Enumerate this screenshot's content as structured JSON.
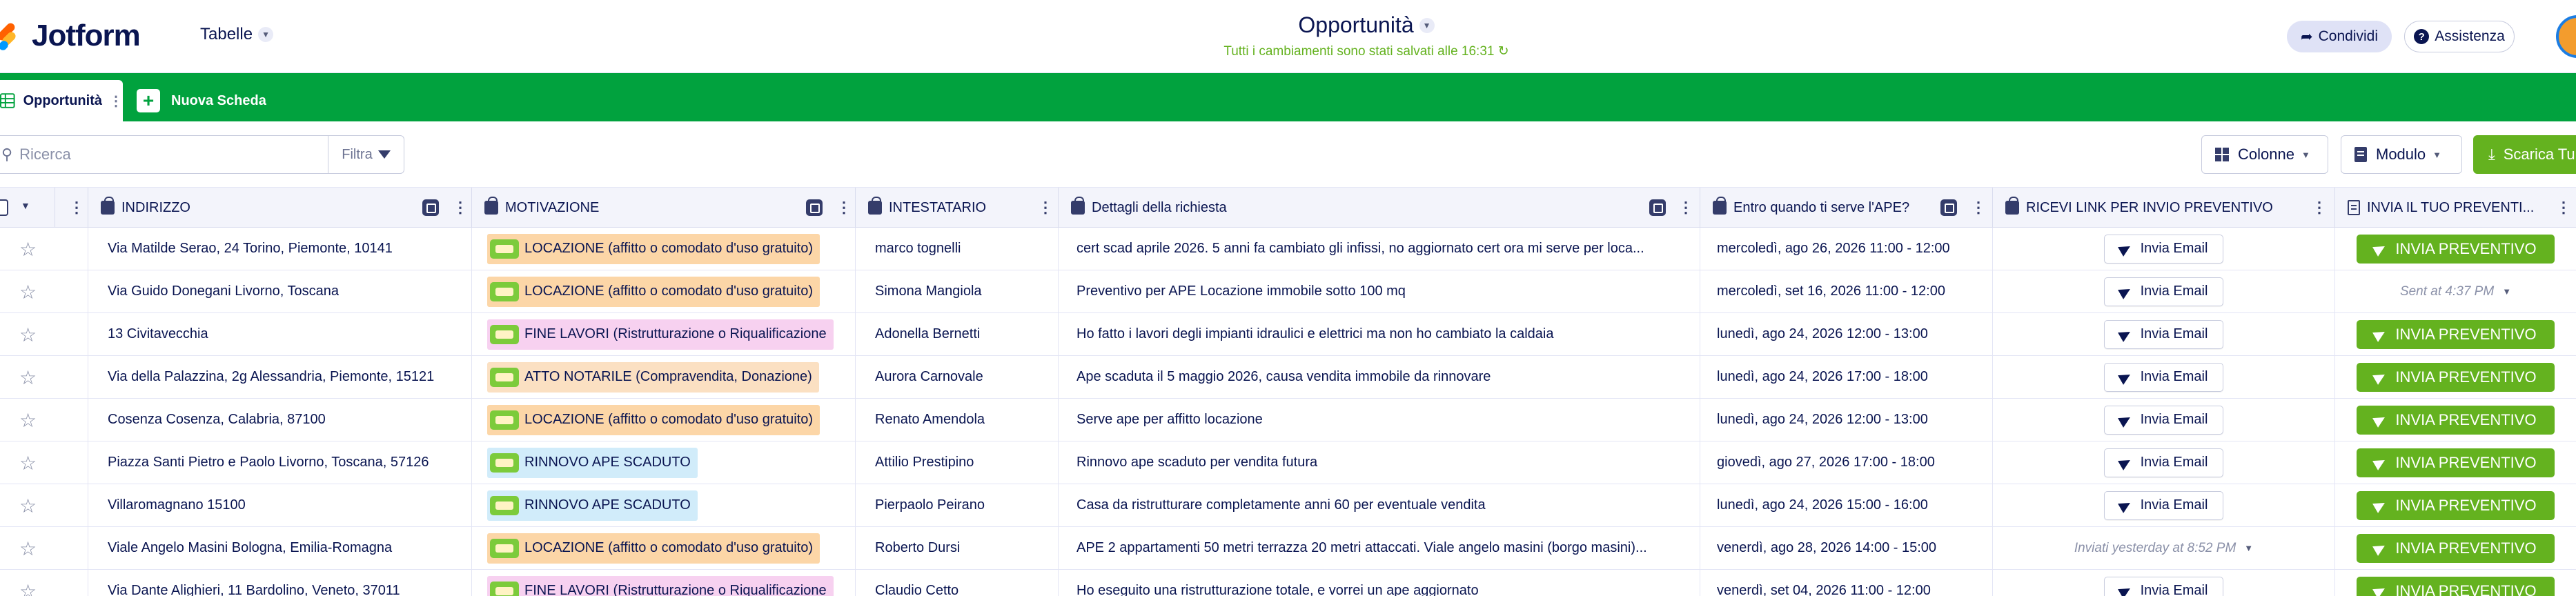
{
  "header": {
    "logo_text": "Jotform",
    "tables_label": "Tabelle",
    "title": "Opportunità",
    "saved_status": "Tutti i cambiamenti sono stati salvati alle 16:31",
    "share_label": "Condividi",
    "help_label": "Assistenza"
  },
  "tabs": {
    "active_label": "Opportunità",
    "new_label": "Nuova Scheda"
  },
  "toolbar": {
    "search_placeholder": "Ricerca",
    "filter_label": "Filtra",
    "columns_label": "Colonne",
    "form_label": "Modulo",
    "download_label": "Scarica Tu"
  },
  "columns": {
    "indirizzo": "INDIRIZZO",
    "motivazione": "MOTIVAZIONE",
    "intestatario": "INTESTATARIO",
    "dettagli": "Dettagli della richiesta",
    "entro": "Entro quando ti serve l'APE?",
    "ricevi": "RICEVI LINK PER INVIO PREVENTIVO",
    "invia": "INVIA IL TUO PREVENTI..."
  },
  "colors": {
    "brand_green": "#01a23e",
    "button_green": "#64b21f",
    "chip_orange": "#fcd6a7",
    "chip_pink": "#f7d1f0",
    "chip_peach": "#fbe0c2",
    "chip_blue": "#d1ecfa"
  },
  "rows": [
    {
      "indirizzo": "Via Matilde Serao, 24  Torino, Piemonte, 10141",
      "motivazione": "LOCAZIONE (affitto o comodato d'uso gratuito)",
      "chip": "orange",
      "intestatario": "marco tognelli",
      "dettagli": "cert scad aprile 2026. 5 anni fa cambiato gli infissi, no aggiornato cert ora mi serve per loca...",
      "entro": "mercoledì, ago 26, 2026 11:00 - 12:00",
      "ricevi": "Invia Email",
      "invia_type": "button",
      "invia": "INVIA PREVENTIVO"
    },
    {
      "indirizzo": "Via Guido Donegani  Livorno, Toscana",
      "motivazione": "LOCAZIONE (affitto o comodato d'uso gratuito)",
      "chip": "orange",
      "intestatario": "Simona Mangiola",
      "dettagli": "Preventivo per APE Locazione immobile sotto 100 mq",
      "entro": "mercoledì, set 16, 2026 11:00 - 12:00",
      "ricevi": "Invia Email",
      "invia_type": "sent",
      "invia": "Sent at 4:37 PM"
    },
    {
      "indirizzo": "13  Civitavecchia",
      "motivazione": "FINE LAVORI (Ristrutturazione o Riqualificazione",
      "chip": "pink",
      "intestatario": "Adonella Bernetti",
      "dettagli": "Ho fatto i lavori degli impianti idraulici e elettrici ma non ho cambiato la caldaia",
      "entro": "lunedì, ago 24, 2026 12:00 - 13:00",
      "ricevi": "Invia Email",
      "invia_type": "button",
      "invia": "INVIA PREVENTIVO"
    },
    {
      "indirizzo": "Via della Palazzina, 2g  Alessandria, Piemonte, 15121",
      "motivazione": "ATTO NOTARILE (Compravendita, Donazione)",
      "chip": "peach",
      "intestatario": "Aurora Carnovale",
      "dettagli": "Ape scaduta il 5 maggio 2026, causa vendita immobile da rinnovare",
      "entro": "lunedì, ago 24, 2026 17:00 - 18:00",
      "ricevi": "Invia Email",
      "invia_type": "button",
      "invia": "INVIA PREVENTIVO"
    },
    {
      "indirizzo": "Cosenza  Cosenza, Calabria, 87100",
      "motivazione": "LOCAZIONE (affitto o comodato d'uso gratuito)",
      "chip": "orange",
      "intestatario": "Renato Amendola",
      "dettagli": "Serve ape per affitto locazione",
      "entro": "lunedì, ago 24, 2026 12:00 - 13:00",
      "ricevi": "Invia Email",
      "invia_type": "button",
      "invia": "INVIA PREVENTIVO"
    },
    {
      "indirizzo": "Piazza Santi Pietro e Paolo  Livorno, Toscana, 57126",
      "motivazione": "RINNOVO APE SCADUTO",
      "chip": "blue",
      "intestatario": "Attilio Prestipino",
      "dettagli": "Rinnovo ape scaduto per vendita futura",
      "entro": "giovedì, ago 27, 2026 17:00 - 18:00",
      "ricevi": "Invia Email",
      "invia_type": "button",
      "invia": "INVIA PREVENTIVO"
    },
    {
      "indirizzo": "Villaromagnano  15100",
      "motivazione": "RINNOVO APE SCADUTO",
      "chip": "blue",
      "intestatario": "Pierpaolo Peirano",
      "dettagli": "Casa da ristrutturare completamente anni 60 per eventuale vendita",
      "entro": "lunedì, ago 24, 2026 15:00 - 16:00",
      "ricevi": "Invia Email",
      "invia_type": "button",
      "invia": "INVIA PREVENTIVO"
    },
    {
      "indirizzo": "Viale Angelo Masini  Bologna, Emilia-Romagna",
      "motivazione": "LOCAZIONE (affitto o comodato d'uso gratuito)",
      "chip": "orange",
      "intestatario": "Roberto Dursi",
      "dettagli": "APE 2 appartamenti 50 metri terrazza 20 metri attaccati. Viale angelo masini (borgo masini)...",
      "entro": "venerdì, ago 28, 2026 14:00 - 15:00",
      "ricevi": "Inviati yesterday at 8:52 PM",
      "ricevi_type": "sent",
      "invia_type": "button",
      "invia": "INVIA PREVENTIVO"
    },
    {
      "indirizzo": "Via Dante Alighieri, 11  Bardolino, Veneto, 37011",
      "motivazione": "FINE LAVORI (Ristrutturazione o Riqualificazione",
      "chip": "pink",
      "intestatario": "Claudio Cetto",
      "dettagli": "Ho eseguito una ristrutturazione totale, e vorrei un ape aggiornato",
      "entro": "venerdì, set 04, 2026 11:00 - 12:00",
      "ricevi": "Invia Email",
      "invia_type": "button",
      "invia": "INVIA PREVENTIVO"
    }
  ]
}
